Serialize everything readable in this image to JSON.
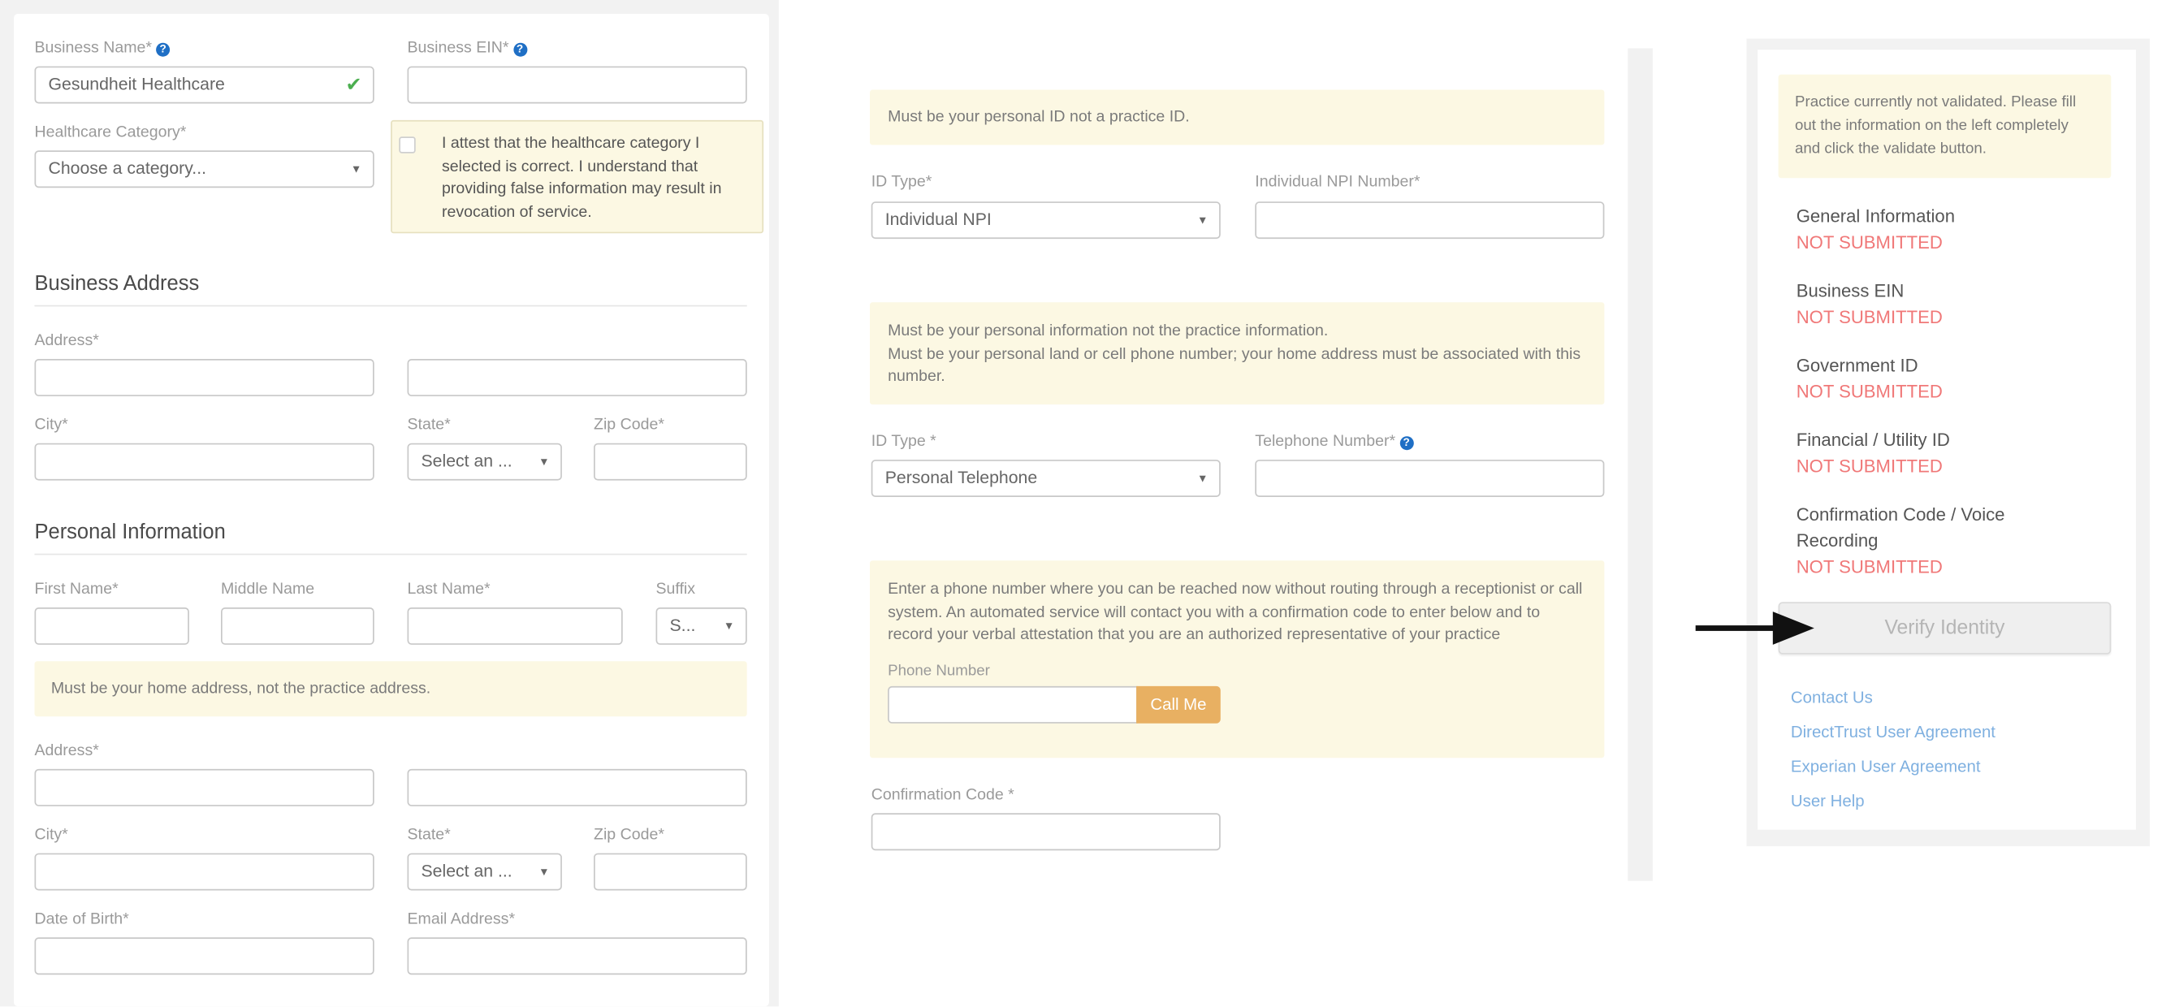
{
  "left": {
    "business_name_label": "Business Name*",
    "business_name_value": "Gesundheit Healthcare",
    "business_ein_label": "Business EIN*",
    "business_ein_value": "",
    "healthcare_category_label": "Healthcare Category*",
    "healthcare_category_value": "Choose a category...",
    "attest_text": "I attest that the healthcare category I selected is correct. I understand that providing false information may result in revocation of service.",
    "business_address": {
      "heading": "Business Address",
      "address_label": "Address*",
      "city_label": "City*",
      "state_label": "State*",
      "state_value": "Select an ...",
      "zip_label": "Zip Code*"
    },
    "personal_info": {
      "heading": "Personal Information",
      "first_name_label": "First Name*",
      "middle_name_label": "Middle Name",
      "last_name_label": "Last Name*",
      "suffix_label": "Suffix",
      "suffix_value": "S...",
      "home_note": "Must be your home address, not the practice address.",
      "address_label": "Address*",
      "city_label": "City*",
      "state_label": "State*",
      "state_value": "Select an ...",
      "zip_label": "Zip Code*",
      "dob_label": "Date of Birth*",
      "email_label": "Email Address*"
    }
  },
  "middle": {
    "id_note": "Must be your personal ID not a practice ID.",
    "id_type_label": "ID Type*",
    "id_type_value": "Individual NPI",
    "npi_label": "Individual NPI Number*",
    "phone_note_1": "Must be your personal information not the practice information.",
    "phone_note_2": "Must be your personal land or cell phone number; your home address must be associated with this number.",
    "id_type2_label": "ID Type *",
    "id_type2_value": "Personal Telephone",
    "telephone_label": "Telephone Number*",
    "callme_note": "Enter a phone number where you can be reached now without routing through a receptionist or call system. An automated service will contact you with a confirmation code to enter below and to record your verbal attestation that you are an authorized representative of your practice",
    "phone_number_label": "Phone Number",
    "call_me_button": "Call Me",
    "confirmation_label": "Confirmation Code *"
  },
  "right": {
    "status_note": "Practice currently not validated. Please fill out the information on the left completely and click the validate button.",
    "items": [
      {
        "label": "General Information",
        "status": "NOT SUBMITTED"
      },
      {
        "label": "Business EIN",
        "status": "NOT SUBMITTED"
      },
      {
        "label": "Government ID",
        "status": "NOT SUBMITTED"
      },
      {
        "label": "Financial / Utility ID",
        "status": "NOT SUBMITTED"
      },
      {
        "label": "Confirmation Code / Voice Recording",
        "status": "NOT SUBMITTED"
      }
    ],
    "verify_button": "Verify Identity",
    "links": [
      "Contact Us",
      "DirectTrust User Agreement",
      "Experian User Agreement",
      "User Help"
    ]
  },
  "icons": {
    "help": "question-circle-icon",
    "check": "checkmark-icon",
    "arrow": "arrow-right-icon",
    "chevron": "chevron-down-icon"
  },
  "colors": {
    "note_bg": "#fcf8e3",
    "status_red": "#f07878",
    "link_blue": "#7fb0e0",
    "call_me_orange": "#e8b062",
    "help_blue": "#1f6fc5",
    "check_green": "#4caf50"
  }
}
